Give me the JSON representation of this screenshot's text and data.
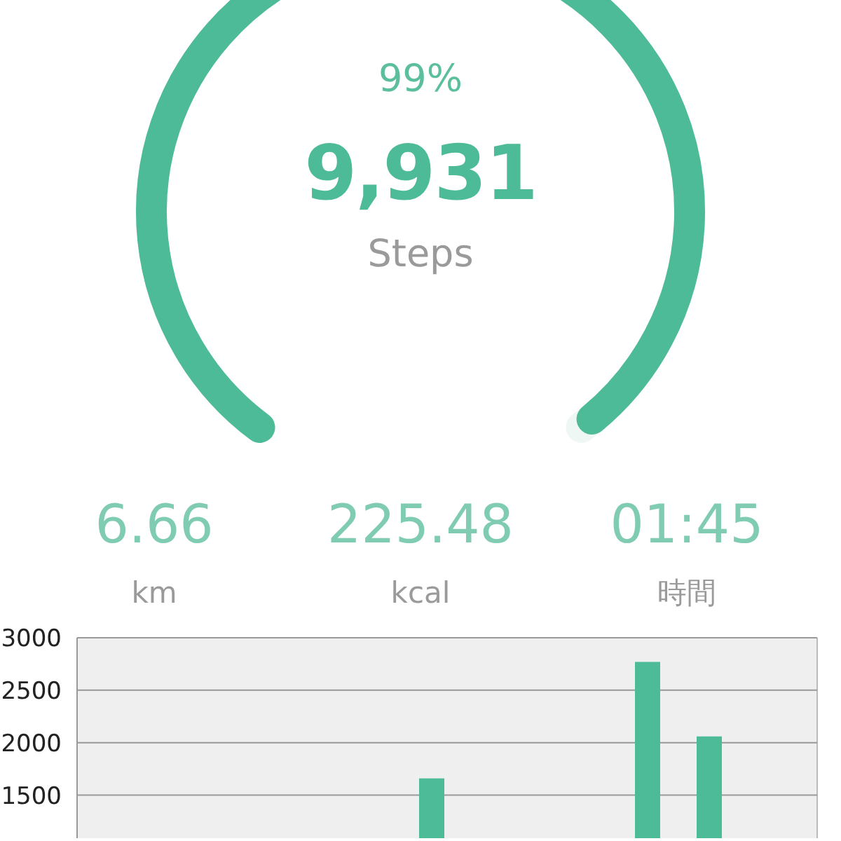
{
  "gauge": {
    "percent": "99%",
    "level": 0.99,
    "count": "9,931",
    "unit": "Steps"
  },
  "stats": [
    {
      "value": "6.66",
      "label": "km"
    },
    {
      "value": "225.48",
      "label": "kcal"
    },
    {
      "value": "01:45",
      "label": "時間"
    }
  ],
  "chart_data": {
    "type": "bar",
    "grid": true,
    "values": [
      null,
      null,
      null,
      null,
      null,
      null,
      null,
      null,
      null,
      null,
      null,
      1660,
      null,
      null,
      null,
      null,
      null,
      null,
      2770,
      null,
      2060,
      null,
      null,
      null
    ],
    "ylim": [
      1090,
      3000
    ],
    "yticks": [
      1500,
      2000,
      2500,
      3000
    ]
  }
}
